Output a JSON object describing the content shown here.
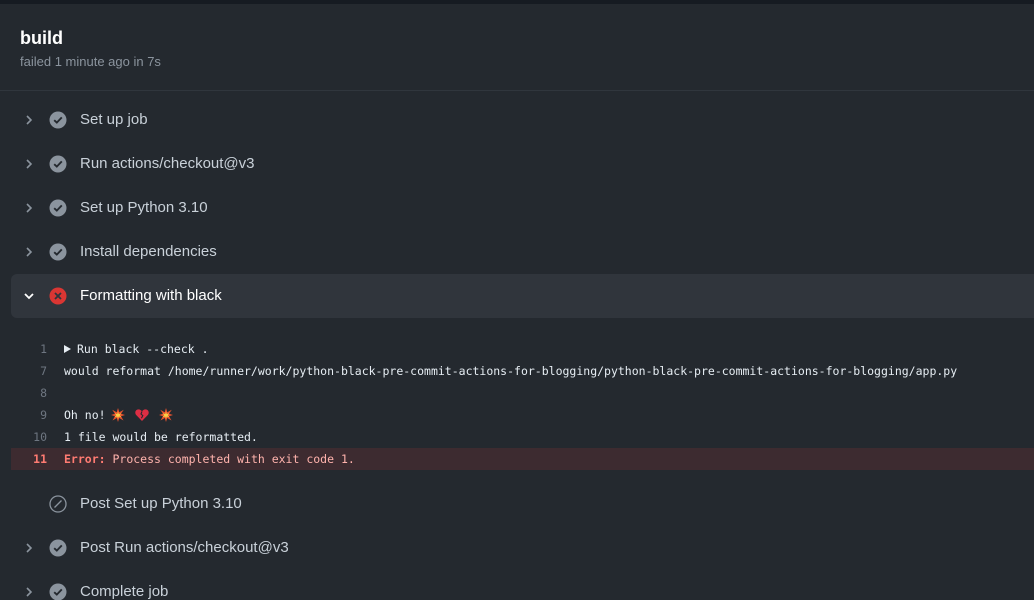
{
  "job": {
    "title": "build",
    "meta": "failed 1 minute ago in 7s"
  },
  "steps_before": [
    {
      "label": "Set up job",
      "status": "success"
    },
    {
      "label": "Run actions/checkout@v3",
      "status": "success"
    },
    {
      "label": "Set up Python 3.10",
      "status": "success"
    },
    {
      "label": "Install dependencies",
      "status": "success"
    }
  ],
  "expanded_step": {
    "label": "Formatting with black",
    "status": "failure"
  },
  "log": {
    "lines": [
      {
        "num": "1",
        "text": "Run black --check ."
      },
      {
        "num": "7",
        "text": "would reformat /home/runner/work/python-black-pre-commit-actions-for-blogging/python-black-pre-commit-actions-for-blogging/app.py"
      },
      {
        "num": "8",
        "text": ""
      },
      {
        "num": "9",
        "text": "Oh no!"
      },
      {
        "num": "10",
        "text": "1 file would be reformatted."
      },
      {
        "num": "11",
        "error_prefix": "Error:",
        "text": " Process completed with exit code 1."
      }
    ],
    "emojis": [
      "collision-icon",
      "broken-heart-icon",
      "collision-icon"
    ]
  },
  "steps_after": [
    {
      "label": "Post Set up Python 3.10",
      "status": "skipped"
    },
    {
      "label": "Post Run actions/checkout@v3",
      "status": "success"
    },
    {
      "label": "Complete job",
      "status": "success"
    }
  ],
  "colors": {
    "background": "#24292f",
    "success_icon": "#8b949e",
    "failure_icon": "#da3633",
    "error_text": "#ff7b72",
    "error_row": "#3d2b30"
  }
}
